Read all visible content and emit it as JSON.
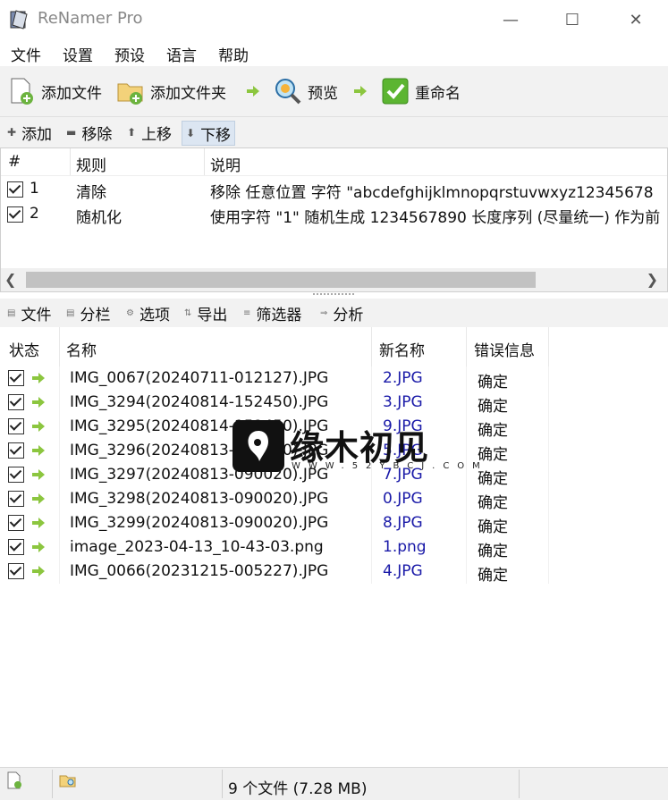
{
  "window": {
    "title": "ReNamer Pro"
  },
  "menu": [
    "文件",
    "设置",
    "预设",
    "语言",
    "帮助"
  ],
  "toolbar": {
    "add_files": "添加文件",
    "add_folder": "添加文件夹",
    "preview": "预览",
    "rename": "重命名"
  },
  "rules_toolbar": {
    "add": "添加",
    "remove": "移除",
    "move_up": "上移",
    "move_down": "下移"
  },
  "rules_table": {
    "headers": [
      "#",
      "规则",
      "说明"
    ],
    "rows": [
      {
        "checked": true,
        "num": "1",
        "rule": "清除",
        "desc": "移除 任意位置 字符 \"abcdefghijklmnopqrstuvwxyz12345678"
      },
      {
        "checked": true,
        "num": "2",
        "rule": "随机化",
        "desc": "使用字符 \"1\" 随机生成 1234567890 长度序列 (尽量统一) 作为前"
      }
    ]
  },
  "files_toolbar": {
    "files": "文件",
    "columns": "分栏",
    "options": "选项",
    "export": "导出",
    "filter": "筛选器",
    "analyze": "分析"
  },
  "files_table": {
    "headers": [
      "状态",
      "名称",
      "新名称",
      "错误信息"
    ],
    "rows": [
      {
        "name": "IMG_0067(20240711-012127).JPG",
        "new_name": "2.JPG",
        "error": "确定"
      },
      {
        "name": "IMG_3294(20240814-152450).JPG",
        "new_name": "3.JPG",
        "error": "确定"
      },
      {
        "name": "IMG_3295(20240814-152450).JPG",
        "new_name": "9.JPG",
        "error": "确定"
      },
      {
        "name": "IMG_3296(20240813-090020).JPG",
        "new_name": "5.JPG",
        "error": "确定"
      },
      {
        "name": "IMG_3297(20240813-090020).JPG",
        "new_name": "7.JPG",
        "error": "确定"
      },
      {
        "name": "IMG_3298(20240813-090020).JPG",
        "new_name": "0.JPG",
        "error": "确定"
      },
      {
        "name": "IMG_3299(20240813-090020).JPG",
        "new_name": "8.JPG",
        "error": "确定"
      },
      {
        "name": "image_2023-04-13_10-43-03.png",
        "new_name": "1.png",
        "error": "确定"
      },
      {
        "name": "IMG_0066(20231215-005227).JPG",
        "new_name": "4.JPG",
        "error": "确定"
      }
    ]
  },
  "statusbar": {
    "summary": "9 个文件 (7.28 MB)"
  },
  "watermark": {
    "text": "缘木初见",
    "url": "WWW.52YBCJ.COM"
  },
  "colors": {
    "new_name": "#1a1aa8",
    "toolbar_bg": "#f2f2f2",
    "arrow_green": "#8cc63f"
  }
}
